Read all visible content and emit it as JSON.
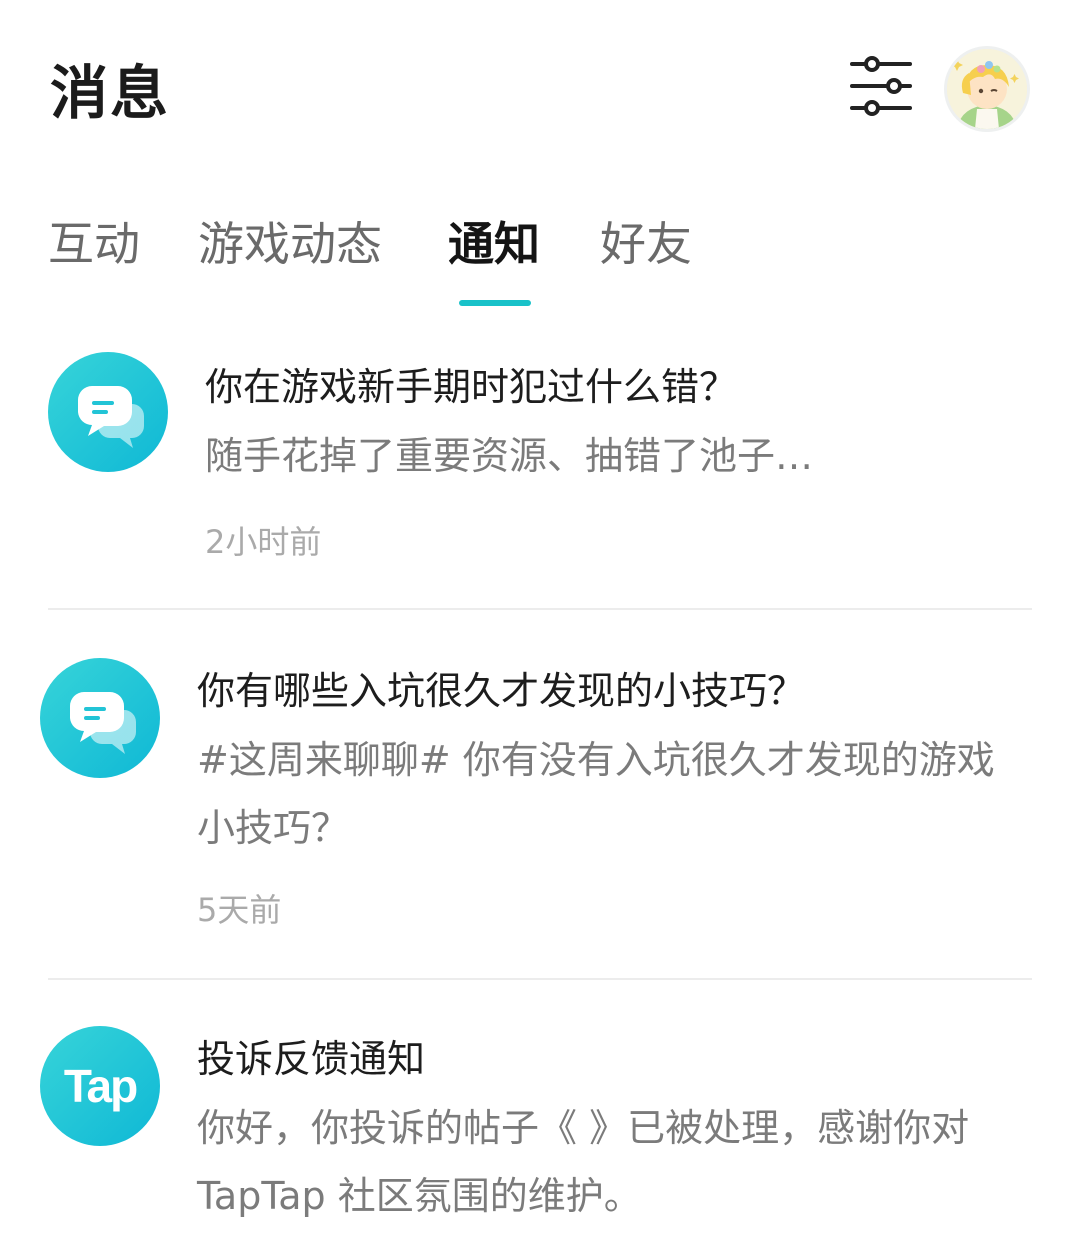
{
  "header": {
    "title": "消息"
  },
  "tabs": [
    {
      "label": "互动"
    },
    {
      "label": "游戏动态"
    },
    {
      "label": "通知"
    },
    {
      "label": "好友"
    }
  ],
  "active_tab": "通知",
  "notifications": [
    {
      "icon": "chat-bubble-icon",
      "title": "你在游戏新手期时犯过什么错？",
      "body": "随手花掉了重要资源、抽错了池子…",
      "time": "2小时前"
    },
    {
      "icon": "chat-bubble-icon",
      "title": "你有哪些入坑很久才发现的小技巧？",
      "body": "#这周来聊聊# 你有没有入坑很久才发现的游戏小技巧？",
      "time": "5天前"
    },
    {
      "icon": "tap-logo-icon",
      "icon_text": "Tap",
      "title": "投诉反馈通知",
      "body": "你好，你投诉的帖子《 》已被处理，感谢你对 TapTap 社区氛围的维护。"
    }
  ],
  "colors": {
    "accent": "#19c2c9",
    "icon_gradient_start": "#37d4d8",
    "icon_gradient_end": "#0fb8d6",
    "title_text": "#1d1d1d",
    "body_text": "#7b7b7b",
    "time_text": "#aaaaaa"
  }
}
